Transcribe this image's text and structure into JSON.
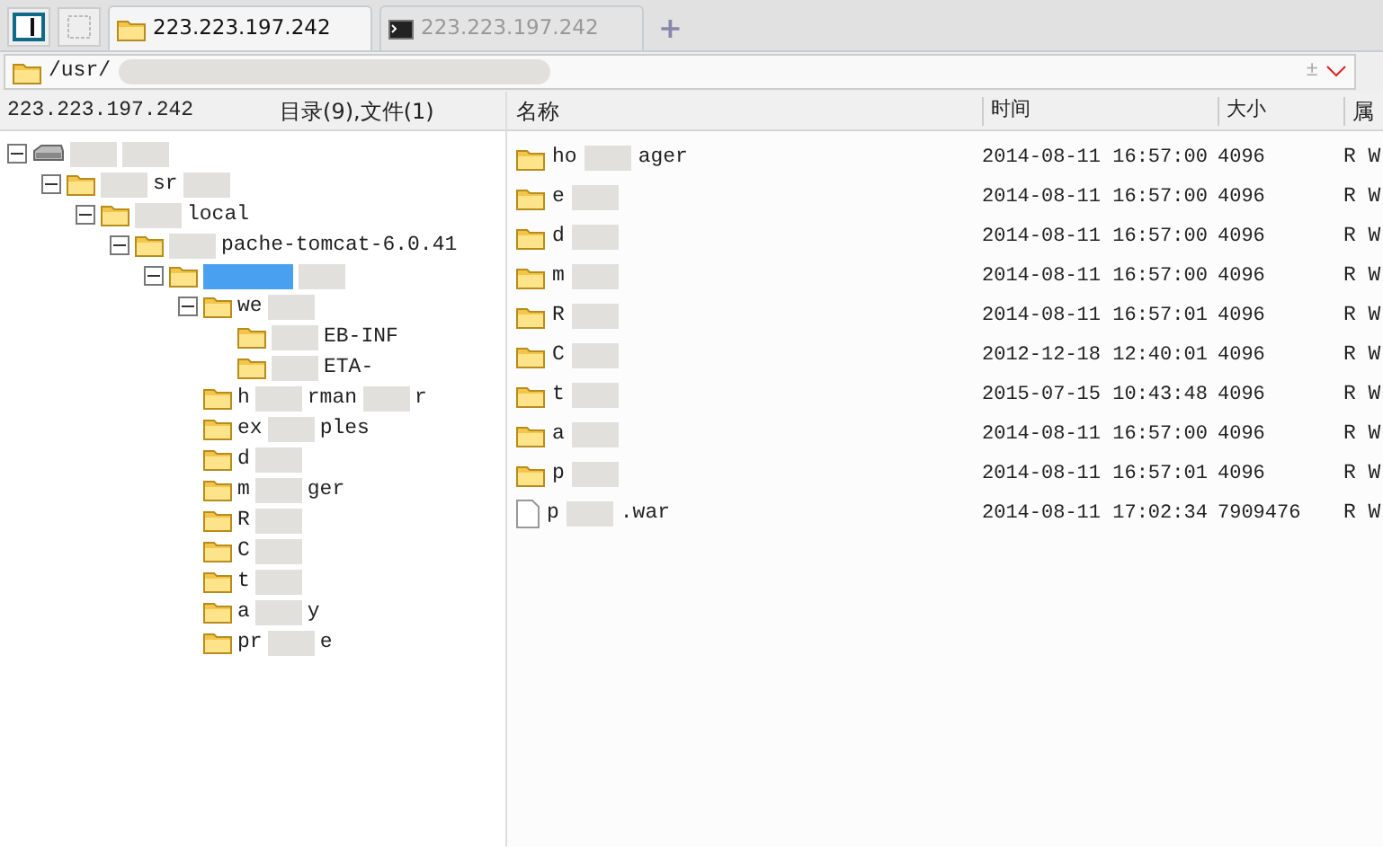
{
  "tabs": [
    {
      "label": "223.223.197.242",
      "kind": "files",
      "selected": true
    },
    {
      "label": "223.223.197.242",
      "kind": "terminal",
      "selected": false
    }
  ],
  "new_tab": "+",
  "address": {
    "value": "/usr/",
    "side_mark": "±"
  },
  "left_header": {
    "host": "223.223.197.242",
    "summary": "目录(9),文件(1)"
  },
  "tree": [
    {
      "kind": "drive",
      "expanded": true,
      "selected": false,
      "children": [
        {
          "kind": "folder",
          "parts": [
            "sr"
          ],
          "expanded": true,
          "selected": false,
          "children": [
            {
              "kind": "folder",
              "parts": [
                "local"
              ],
              "expanded": true,
              "selected": false,
              "children": [
                {
                  "kind": "folder",
                  "parts": [
                    "pache-tomcat-6.0.41"
                  ],
                  "expanded": true,
                  "selected": false,
                  "children": [
                    {
                      "kind": "folder",
                      "expanded": true,
                      "selected": true,
                      "children": [
                        {
                          "kind": "folder",
                          "parts": [
                            "we"
                          ],
                          "expanded": true,
                          "selected": false,
                          "children": [
                            {
                              "kind": "folder",
                              "parts": [
                                "EB-INF"
                              ],
                              "selected": false
                            },
                            {
                              "kind": "folder",
                              "parts": [
                                "ETA-"
                              ],
                              "selected": false
                            }
                          ]
                        },
                        {
                          "kind": "folder",
                          "parts": [
                            "h",
                            "rman",
                            "r"
                          ],
                          "selected": false
                        },
                        {
                          "kind": "folder",
                          "parts": [
                            "ex",
                            "ples"
                          ],
                          "selected": false
                        },
                        {
                          "kind": "folder",
                          "parts": [
                            "d"
                          ],
                          "selected": false
                        },
                        {
                          "kind": "folder",
                          "parts": [
                            "m",
                            "ger"
                          ],
                          "selected": false
                        },
                        {
                          "kind": "folder",
                          "parts": [
                            "R"
                          ],
                          "selected": false
                        },
                        {
                          "kind": "folder",
                          "parts": [
                            "C"
                          ],
                          "selected": false
                        },
                        {
                          "kind": "folder",
                          "parts": [
                            "t"
                          ],
                          "selected": false
                        },
                        {
                          "kind": "folder",
                          "parts": [
                            "a",
                            "y"
                          ],
                          "selected": false
                        },
                        {
                          "kind": "folder",
                          "parts": [
                            "pr",
                            "e"
                          ],
                          "selected": false
                        }
                      ]
                    }
                  ]
                }
              ]
            }
          ]
        }
      ]
    }
  ],
  "table": {
    "columns": [
      "名称",
      "时间",
      "大小",
      "属"
    ],
    "rows": [
      {
        "kind": "folder",
        "parts": [
          "ho",
          "ager"
        ],
        "time": "2014-08-11 16:57:00",
        "size": "4096",
        "attr": "R W"
      },
      {
        "kind": "folder",
        "parts": [
          "e"
        ],
        "time": "2014-08-11 16:57:00",
        "size": "4096",
        "attr": "R W"
      },
      {
        "kind": "folder",
        "parts": [
          "d"
        ],
        "time": "2014-08-11 16:57:00",
        "size": "4096",
        "attr": "R W"
      },
      {
        "kind": "folder",
        "parts": [
          "m"
        ],
        "time": "2014-08-11 16:57:00",
        "size": "4096",
        "attr": "R W"
      },
      {
        "kind": "folder",
        "parts": [
          "R"
        ],
        "time": "2014-08-11 16:57:01",
        "size": "4096",
        "attr": "R W"
      },
      {
        "kind": "folder",
        "parts": [
          "C"
        ],
        "time": "2012-12-18 12:40:01",
        "size": "4096",
        "attr": "R W"
      },
      {
        "kind": "folder",
        "parts": [
          "t"
        ],
        "time": "2015-07-15 10:43:48",
        "size": "4096",
        "attr": "R W"
      },
      {
        "kind": "folder",
        "parts": [
          "a"
        ],
        "time": "2014-08-11 16:57:00",
        "size": "4096",
        "attr": "R W"
      },
      {
        "kind": "folder",
        "parts": [
          "p"
        ],
        "time": "2014-08-11 16:57:01",
        "size": "4096",
        "attr": "R W"
      },
      {
        "kind": "file",
        "parts": [
          "p",
          ".war"
        ],
        "time": "2014-08-11 17:02:34",
        "size": "7909476",
        "attr": "R W"
      }
    ]
  }
}
